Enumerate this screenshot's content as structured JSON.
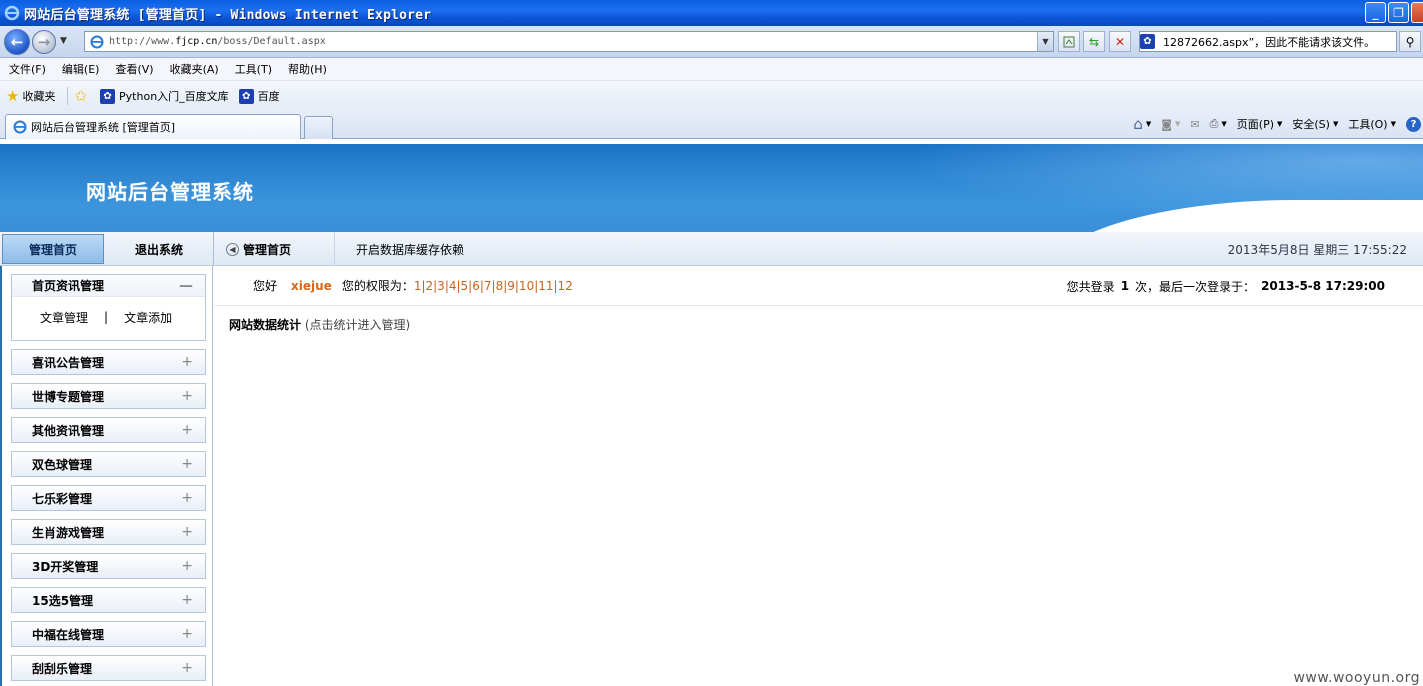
{
  "window": {
    "title": "网站后台管理系统 [管理首页] - Windows Internet Explorer",
    "controls": [
      "_",
      "❐",
      "×"
    ]
  },
  "address": {
    "url_prefix": "http://www.",
    "url_host": "fjcp.cn",
    "url_path": "/boss/Default.aspx",
    "search_text": "12872662.aspx”，因此不能请求该文件。"
  },
  "menu": [
    "文件(F)",
    "编辑(E)",
    "查看(V)",
    "收藏夹(A)",
    "工具(T)",
    "帮助(H)"
  ],
  "favorites": {
    "label": "收藏夹",
    "items": [
      "Python入门_百度文库",
      "百度"
    ]
  },
  "tab": {
    "title": "网站后台管理系统 [管理首页]"
  },
  "commands": {
    "page": "页面(P)",
    "safety": "安全(S)",
    "tools": "工具(O)"
  },
  "site": {
    "title": "网站后台管理系统"
  },
  "subnav": {
    "home": "管理首页",
    "logout": "退出系统",
    "crumb": "管理首页",
    "cache": "开启数据库缓存依赖",
    "datetime": "2013年5月8日 星期三 17:55:22"
  },
  "sidebar": {
    "open_group": {
      "title": "首页资讯管理",
      "links": [
        "文章管理",
        "文章添加"
      ]
    },
    "groups": [
      "喜讯公告管理",
      "世博专题管理",
      "其他资讯管理",
      "双色球管理",
      "七乐彩管理",
      "生肖游戏管理",
      "3D开奖管理",
      "15选5管理",
      "中福在线管理",
      "刮刮乐管理"
    ]
  },
  "main": {
    "hello": "您好",
    "user": "xiejue",
    "perm_label": "您的权限为：",
    "perm_value": "1|2|3|4|5|6|7|8|9|10|11|12",
    "login_prefix": "您共登录",
    "login_count": "1",
    "login_mid": "次，最后一次登录于：",
    "last_login": "2013-5-8 17:29:00",
    "stats_title": "网站数据统计",
    "stats_hint": "(点击统计进入管理)"
  },
  "watermark": "www.wooyun.org"
}
